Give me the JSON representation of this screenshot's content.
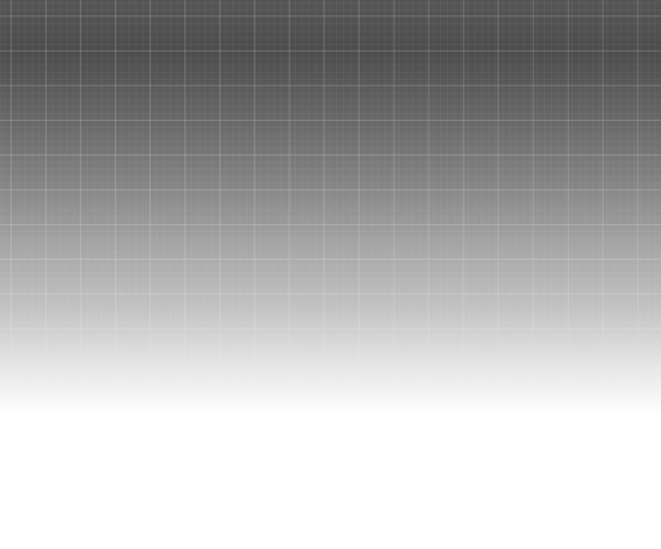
{
  "page": {
    "background": "#ffffff",
    "header_gradient_top": "#555555",
    "header_gradient_bottom": "#ffffff",
    "grid_line_color": "#ffffff"
  }
}
